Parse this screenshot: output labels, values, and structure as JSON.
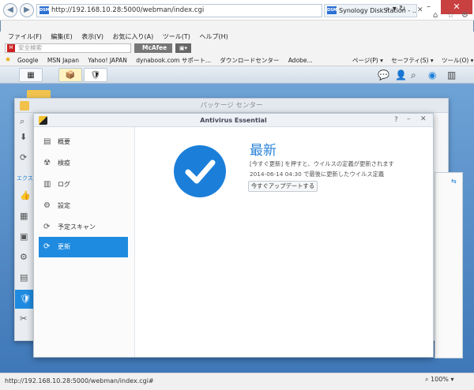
{
  "browser": {
    "url": "http://192.168.10.28:5000/webman/index.cgi",
    "url_icons": "⌕ ▾ ↻",
    "tab_title": "Synology DiskStation - ...",
    "tab_favicon": "DSM",
    "minimize": "–",
    "maximize": "□",
    "close": "✕",
    "menu": [
      "ファイル(F)",
      "編集(E)",
      "表示(V)",
      "お気に入り(A)",
      "ツール(T)",
      "ヘルプ(H)"
    ],
    "search_placeholder": "安全検索",
    "mcafee": "McAfee",
    "favorites": [
      "Google",
      "MSN Japan",
      "Yahoo! JAPAN",
      "dynabook.com サポート...",
      "ダウンロードセンター",
      "Adobe..."
    ],
    "fav_tools": [
      "ページ(P) ▾",
      "セーフティ(S) ▾",
      "ツール(O) ▾",
      "?"
    ],
    "status_url": "http://192.168.10.28:5000/webman/index.cgi#",
    "zoom": "100%"
  },
  "dsm": {
    "package_center_title": "パッケージ センター",
    "package_left_icons": [
      "⬇",
      "⟳",
      "エクス",
      "👍",
      "▦",
      "▣",
      "⚙",
      "▤",
      "🛡",
      "✂"
    ]
  },
  "antivirus": {
    "title": "Antivirus Essential",
    "nav": [
      {
        "label": "概要",
        "icon": "overview-icon"
      },
      {
        "label": "検疫",
        "icon": "quarantine-icon"
      },
      {
        "label": "ログ",
        "icon": "log-icon"
      },
      {
        "label": "設定",
        "icon": "settings-icon"
      },
      {
        "label": "予定スキャン",
        "icon": "schedule-icon"
      },
      {
        "label": "更新",
        "icon": "update-icon",
        "active": true
      }
    ],
    "status_title": "最新",
    "status_desc": "[今すぐ更新] を押すと、ウイルスの定義が更新されます",
    "status_time": "2014-06-14 04:30 で最後に更新したウイルス定義",
    "update_button": "今すぐアップデートする"
  },
  "colors": {
    "accent": "#1f8be0",
    "check": "#1b7fd9",
    "title_blue": "#2a84d8"
  }
}
